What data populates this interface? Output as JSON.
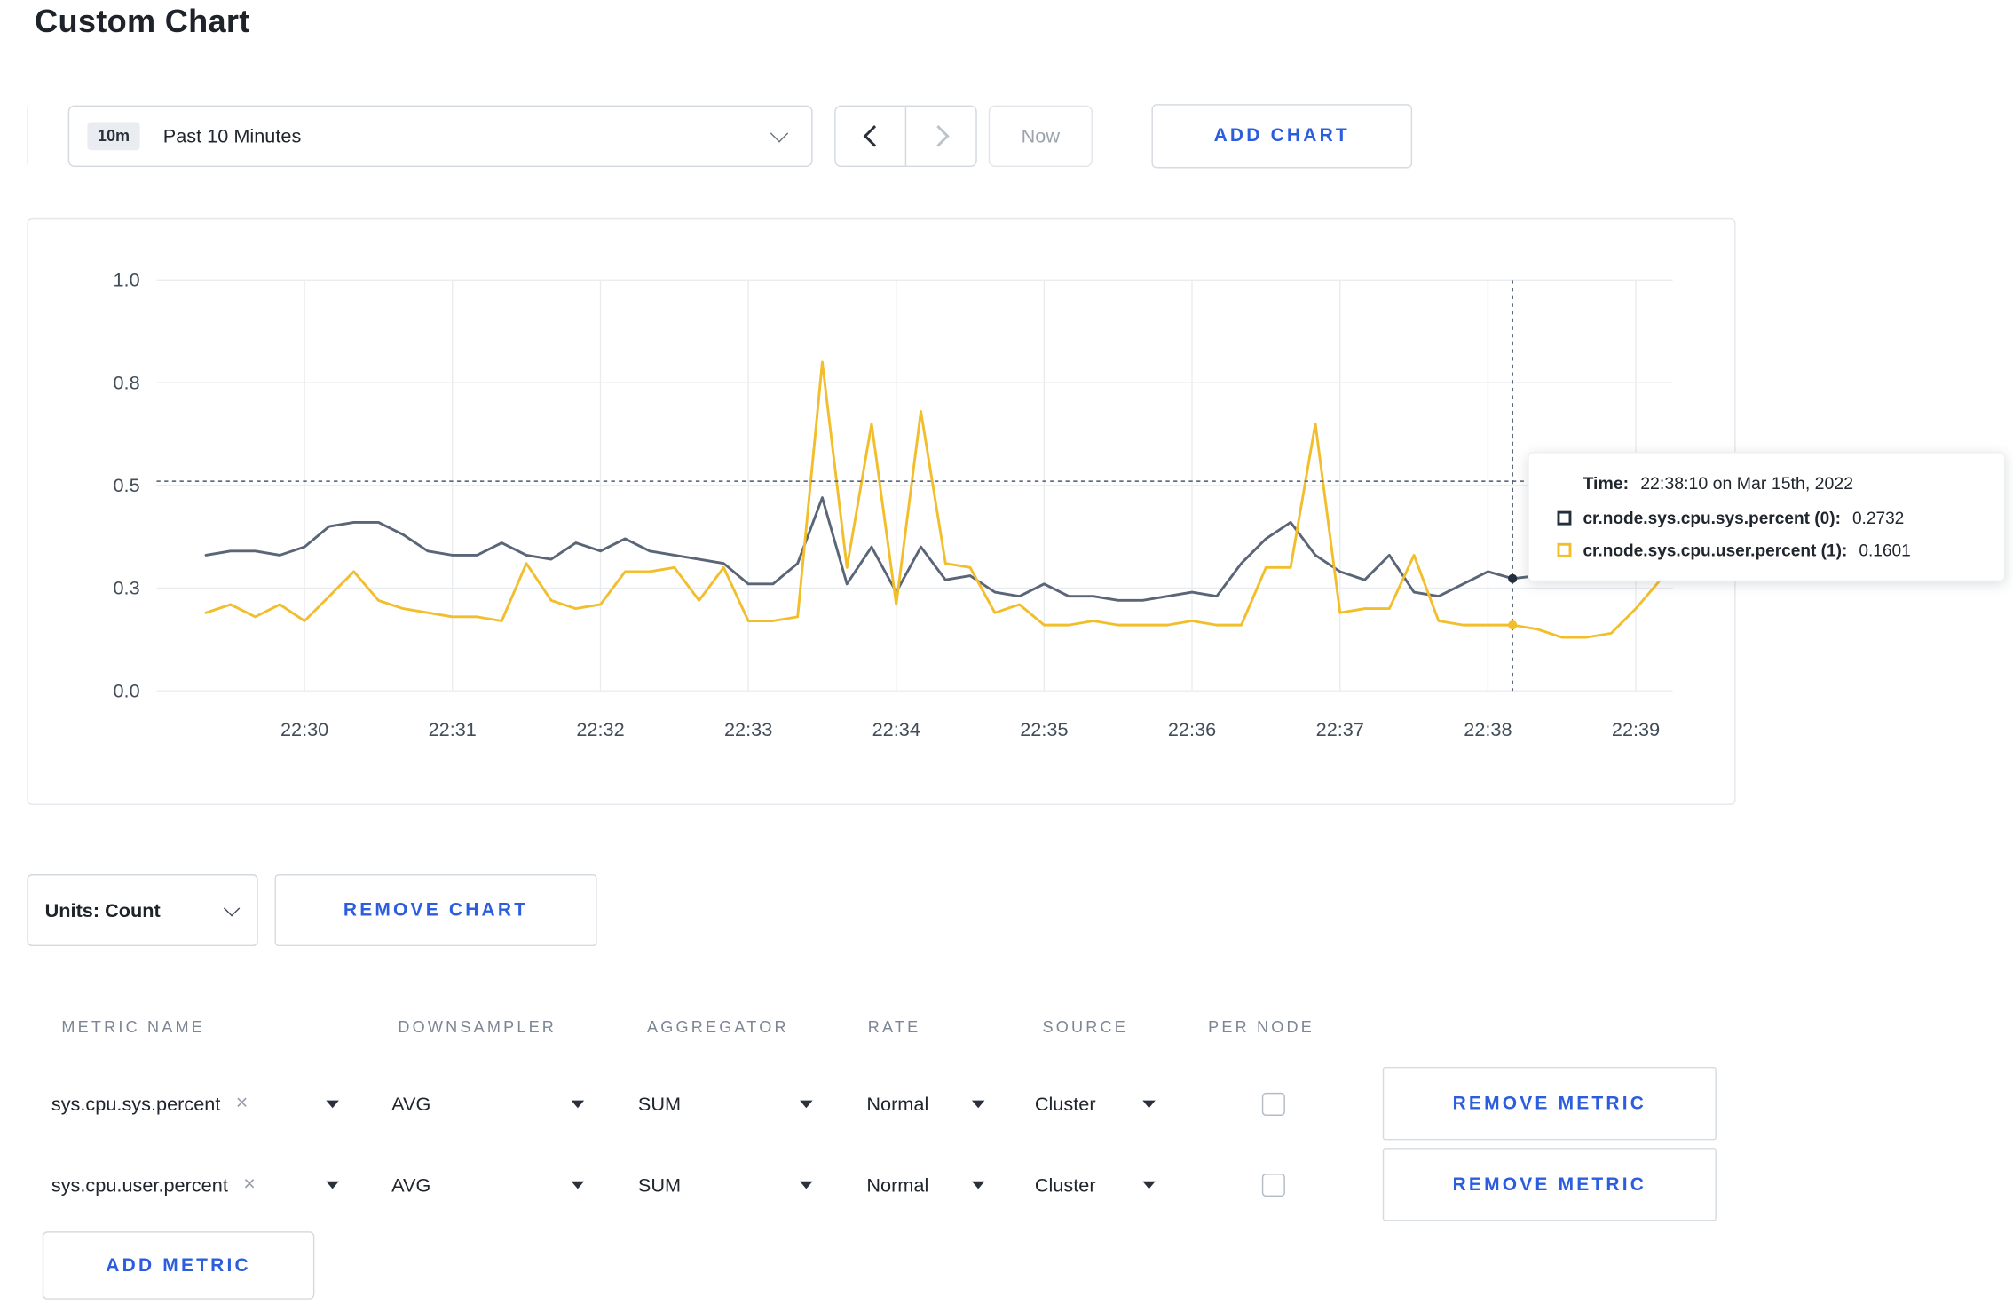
{
  "page": {
    "title": "Custom Chart"
  },
  "toolbar": {
    "time_window_badge": "10m",
    "time_window_label": "Past 10 Minutes",
    "now_label": "Now",
    "add_chart_label": "ADD CHART"
  },
  "chart_controls": {
    "units_label": "Units: Count",
    "remove_chart_label": "REMOVE CHART"
  },
  "metrics_table": {
    "headers": [
      "METRIC NAME",
      "DOWNSAMPLER",
      "AGGREGATOR",
      "RATE",
      "SOURCE",
      "PER NODE"
    ],
    "rows": [
      {
        "name": "sys.cpu.sys.percent",
        "downsampler": "AVG",
        "aggregator": "SUM",
        "rate": "Normal",
        "source": "Cluster",
        "per_node_checked": false,
        "remove_label": "REMOVE METRIC"
      },
      {
        "name": "sys.cpu.user.percent",
        "downsampler": "AVG",
        "aggregator": "SUM",
        "rate": "Normal",
        "source": "Cluster",
        "per_node_checked": false,
        "remove_label": "REMOVE METRIC"
      }
    ],
    "add_metric_label": "ADD METRIC"
  },
  "icons": {
    "clear": "×"
  },
  "colors": {
    "accent_blue": "#2b5dde",
    "series_sys": "#5a6577",
    "series_user": "#f2be2c"
  },
  "chart_data": {
    "type": "line",
    "title": "",
    "xlabel": "",
    "ylabel": "",
    "ylim": [
      0,
      1
    ],
    "grid": true,
    "legend": "none",
    "x_domain": [
      "22:29:00",
      "22:39:15"
    ],
    "x_ticks": [
      "22:30",
      "22:31",
      "22:32",
      "22:33",
      "22:34",
      "22:35",
      "22:36",
      "22:37",
      "22:38",
      "22:39"
    ],
    "y_ticks": [
      {
        "value": 0,
        "label": "0.0"
      },
      {
        "value": 0.25,
        "label": "0.3"
      },
      {
        "value": 0.5,
        "label": "0.5"
      },
      {
        "value": 0.75,
        "label": "0.8"
      },
      {
        "value": 1,
        "label": "1.0"
      }
    ],
    "series_start": "22:29:20",
    "interval_seconds": 10,
    "series": [
      {
        "name": "cr.node.sys.cpu.sys.percent",
        "color": "#5a6577",
        "values": [
          0.33,
          0.34,
          0.34,
          0.33,
          0.35,
          0.4,
          0.41,
          0.41,
          0.38,
          0.34,
          0.33,
          0.33,
          0.36,
          0.33,
          0.32,
          0.36,
          0.34,
          0.37,
          0.34,
          0.33,
          0.32,
          0.31,
          0.26,
          0.26,
          0.31,
          0.47,
          0.26,
          0.35,
          0.24,
          0.35,
          0.27,
          0.28,
          0.24,
          0.23,
          0.26,
          0.23,
          0.23,
          0.22,
          0.22,
          0.23,
          0.24,
          0.23,
          0.31,
          0.37,
          0.41,
          0.33,
          0.29,
          0.27,
          0.33,
          0.24,
          0.23,
          0.26,
          0.29,
          0.2732,
          0.28,
          0.29,
          0.3,
          0.29,
          0.28,
          0.3
        ]
      },
      {
        "name": "cr.node.sys.cpu.user.percent",
        "color": "#f2be2c",
        "values": [
          0.19,
          0.21,
          0.18,
          0.21,
          0.17,
          0.23,
          0.29,
          0.22,
          0.2,
          0.19,
          0.18,
          0.18,
          0.17,
          0.31,
          0.22,
          0.2,
          0.21,
          0.29,
          0.29,
          0.3,
          0.22,
          0.3,
          0.17,
          0.17,
          0.18,
          0.8,
          0.3,
          0.65,
          0.21,
          0.68,
          0.31,
          0.3,
          0.19,
          0.21,
          0.16,
          0.16,
          0.17,
          0.16,
          0.16,
          0.16,
          0.17,
          0.16,
          0.16,
          0.3,
          0.3,
          0.65,
          0.19,
          0.2,
          0.2,
          0.33,
          0.17,
          0.16,
          0.16,
          0.1601,
          0.15,
          0.13,
          0.13,
          0.14,
          0.2,
          0.27
        ]
      }
    ],
    "crosshair": {
      "time": "22:38:10",
      "hover_value": 0.51
    },
    "tooltip": {
      "time_label": "Time:",
      "time_value": "22:38:10 on Mar 15th, 2022",
      "rows": [
        {
          "name": "cr.node.sys.cpu.sys.percent (0):",
          "value": "0.2732",
          "color": "#22303e"
        },
        {
          "name": "cr.node.sys.cpu.user.percent (1):",
          "value": "0.1601",
          "color": "#f2be2c"
        }
      ]
    }
  }
}
